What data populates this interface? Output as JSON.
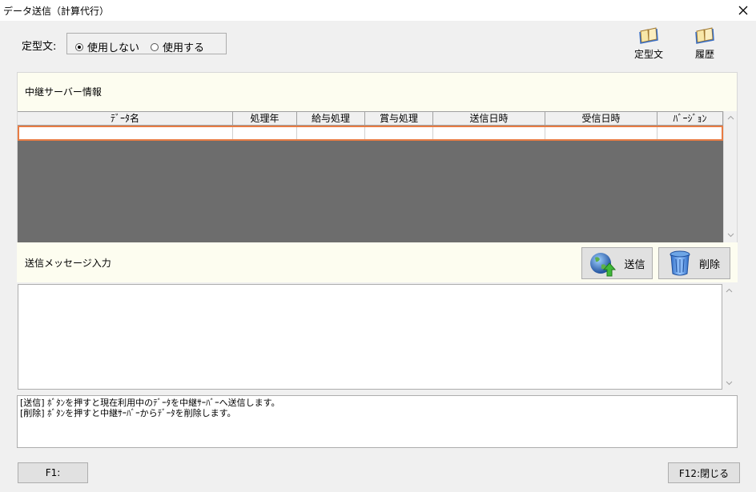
{
  "window": {
    "title": "データ送信（計算代行）"
  },
  "template": {
    "label": "定型文:",
    "options": [
      {
        "label": "使用しない",
        "selected": true
      },
      {
        "label": "使用する",
        "selected": false
      }
    ]
  },
  "top_buttons": {
    "template_label": "定型文",
    "history_label": "履歴"
  },
  "relay_panel": {
    "title": "中継サーバー情報",
    "columns": [
      "ﾃﾞｰﾀ名",
      "処理年",
      "給与処理",
      "賞与処理",
      "送信日時",
      "受信日時",
      "ﾊﾞｰｼﾞｮﾝ"
    ],
    "rows": [
      [
        "",
        "",
        "",
        "",
        "",
        "",
        ""
      ]
    ]
  },
  "message_panel": {
    "title": "送信メッセージ入力",
    "send_label": "送信",
    "delete_label": "削除",
    "message_value": ""
  },
  "help": {
    "lines": [
      "[送信] ﾎﾞﾀﾝを押すと現在利用中のﾃﾞｰﾀを中継ｻｰﾊﾞｰへ送信します。",
      "[削除] ﾎﾞﾀﾝを押すと中継ｻｰﾊﾞｰからﾃﾞｰﾀを削除します。"
    ]
  },
  "fkeys": {
    "f1_label": "F1:",
    "f12_label": "F12:閉じる"
  },
  "colors": {
    "panel_bg": "#fdfdf0",
    "grid_bg": "#6d6d6d",
    "row_highlight": "#e87c44"
  },
  "icons": {
    "close": "close-icon",
    "template": "book-icon",
    "history": "book-icon",
    "send": "globe-upload-icon",
    "delete": "trash-can-icon"
  }
}
